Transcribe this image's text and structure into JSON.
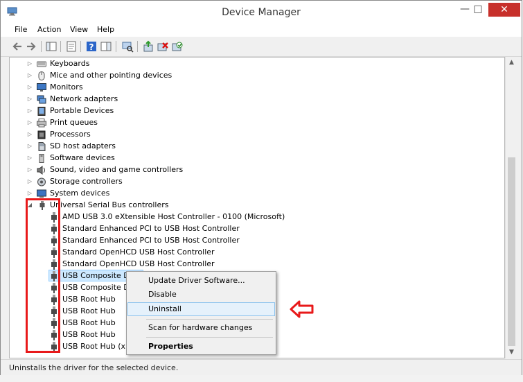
{
  "window": {
    "title": "Device Manager"
  },
  "menu": [
    "File",
    "Action",
    "View",
    "Help"
  ],
  "tree": {
    "categories": [
      "Keyboards",
      "Mice and other pointing devices",
      "Monitors",
      "Network adapters",
      "Portable Devices",
      "Print queues",
      "Processors",
      "SD host adapters",
      "Software devices",
      "Sound, video and game controllers",
      "Storage controllers",
      "System devices"
    ],
    "usb_category": "Universal Serial Bus controllers",
    "usb_devices": [
      "AMD USB 3.0 eXtensible Host Controller - 0100 (Microsoft)",
      "Standard Enhanced PCI to USB Host Controller",
      "Standard Enhanced PCI to USB Host Controller",
      "Standard OpenHCD USB Host Controller",
      "Standard OpenHCD USB Host Controller",
      "USB Composite Device",
      "USB Composite Device",
      "USB Root Hub",
      "USB Root Hub",
      "USB Root Hub",
      "USB Root Hub",
      "USB Root Hub (xHCI)"
    ]
  },
  "context_menu": {
    "update_driver": "Update Driver Software...",
    "disable": "Disable",
    "uninstall": "Uninstall",
    "scan": "Scan for hardware changes",
    "properties": "Properties"
  },
  "status_bar": "Uninstalls the driver for the selected device.",
  "colors": {
    "selection": "#cce8ff",
    "annotation_red": "#e8191a",
    "close_button": "#c7302b"
  }
}
